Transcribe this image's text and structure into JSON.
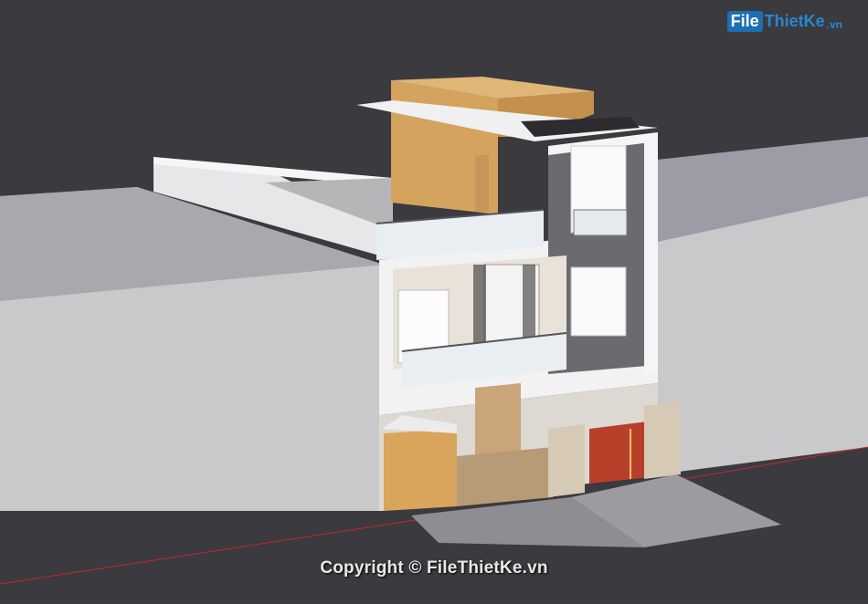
{
  "logo": {
    "file": "File",
    "rest": "ThietKe",
    "domain": ".vn"
  },
  "watermark": "Copyright © FileThietKe.vn",
  "colors": {
    "background": "#3a3a3f",
    "ground_gray": "#c9c9cb",
    "wood": "#d9a45c",
    "facade_white": "#f2f2f2",
    "gate_red": "#b8402a",
    "street_line": "#c0292b"
  }
}
